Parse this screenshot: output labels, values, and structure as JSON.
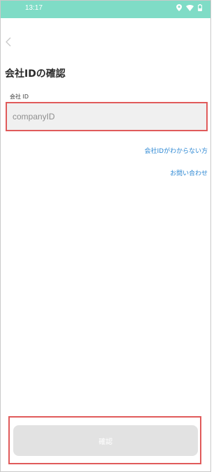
{
  "status_bar": {
    "time": "13:17",
    "icons": [
      "location-icon",
      "wifi-icon",
      "battery-icon"
    ],
    "background": "#7fdcc6"
  },
  "header": {
    "back_icon": "chevron-left-icon",
    "title": "会社IDの確認"
  },
  "form": {
    "company_label": "会社 ID",
    "company_placeholder": "companyID",
    "company_value": ""
  },
  "links": {
    "forgot_company_id": "会社IDがわからない方",
    "contact": "お問い合わせ"
  },
  "actions": {
    "confirm_label": "確認"
  },
  "colors": {
    "highlight": "#e05a5a",
    "link": "#2b87d3",
    "button_disabled": "#e2e2e2"
  }
}
